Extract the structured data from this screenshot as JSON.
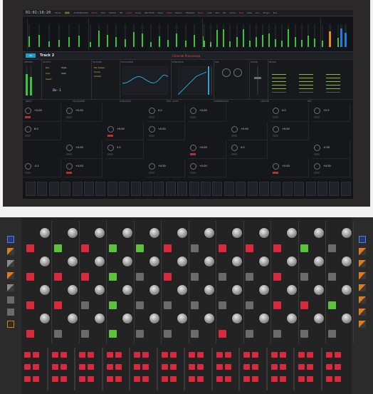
{
  "topbar": {
    "timecode": "01:02:19:20",
    "items": [
      "Mode",
      "Edit",
      "AUTOMATION",
      "Write",
      "Trim",
      "TRACK",
      "Off",
      "Latch",
      "Snap",
      "ON STOP",
      "Clear",
      "Fade",
      "Return",
      "ENABLE",
      "Read",
      "Auto",
      "Pan",
      "EQ",
      "Comp",
      "Exp",
      "Gate",
      "Aux",
      "Plugin",
      "Bus"
    ]
  },
  "strip": {
    "chip": "3A",
    "track_name": "Track 2",
    "processing": "Channel Processing"
  },
  "row2": {
    "panels": [
      "METERS",
      "STATUS",
      "PLUGINS",
      "EQUALIZER",
      "DYNAMICS",
      "MIX",
      "FADER",
      "BUSES"
    ],
    "status_lines": [
      "Rec",
      "Mute",
      "Solo",
      "Safe",
      "Insert"
    ],
    "plugin_lines": [
      "EQ Classic",
      "Comp",
      "Limiter"
    ],
    "input_value": "Dx - 1"
  },
  "sect": {
    "headers": [
      "INPUT",
      "EQUALIZER",
      "DYNAMICS",
      "EXP / GATE",
      "COMPRESSOR",
      "LIMITER",
      "MIX"
    ],
    "values": [
      "+0.00",
      "+0.00",
      "0.0",
      "+0.00",
      "0.0",
      "+2.3",
      "8.0",
      "+0.00",
      "+0.00",
      "+0.00",
      "+0.00",
      "+0.00",
      "3.0",
      "+0.00",
      "0.0",
      "-0.55",
      "-0.1",
      "+0.00",
      "+0.00",
      "+0.00",
      "+0.00",
      "+0.00"
    ]
  },
  "colors": {
    "pad_red": "#d82a3c",
    "pad_green": "#5cc23a",
    "pad_gray": "#6b6b6b",
    "side_blue": "#2a4a9a",
    "side_orange": "#e07a1a",
    "meter_green": "#3cc23c"
  },
  "console": {
    "side_left": [
      "blue-square",
      "orange-diag",
      "gray-diag",
      "orange-diag",
      "gray-diag",
      "gray-square",
      "gray-square",
      "orange-outline"
    ],
    "side_right": [
      "blue-square",
      "orange-diag",
      "orange-diag",
      "orange-diag",
      "orange-diag",
      "orange-diag",
      "orange-diag",
      "orange-diag"
    ],
    "channels": [
      {
        "pads": [
          "red",
          "red",
          "red",
          "red"
        ]
      },
      {
        "pads": [
          "green",
          "red",
          "red",
          "gray"
        ]
      },
      {
        "pads": [
          "red",
          "red",
          "gray",
          "gray"
        ]
      },
      {
        "pads": [
          "green",
          "green",
          "green",
          "green"
        ]
      },
      {
        "pads": [
          "green",
          "gray",
          "gray",
          "gray"
        ]
      },
      {
        "pads": [
          "red",
          "red",
          "gray",
          "gray"
        ]
      },
      {
        "pads": [
          "gray",
          "gray",
          "gray",
          "gray"
        ]
      },
      {
        "pads": [
          "red",
          "gray",
          "gray",
          "red"
        ]
      },
      {
        "pads": [
          "red",
          "gray",
          "gray",
          "gray"
        ]
      },
      {
        "pads": [
          "red",
          "red",
          "red",
          "gray"
        ]
      },
      {
        "pads": [
          "green",
          "gray",
          "red",
          "gray"
        ]
      },
      {
        "pads": [
          "gray",
          "gray",
          "green",
          "gray"
        ]
      }
    ]
  }
}
